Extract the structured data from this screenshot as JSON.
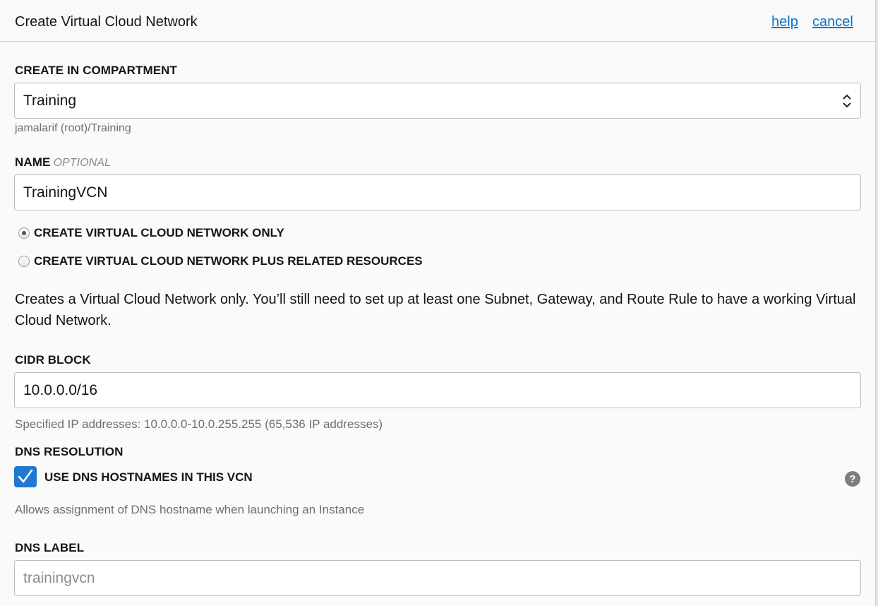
{
  "header": {
    "title": "Create Virtual Cloud Network",
    "help_label": "help",
    "cancel_label": "cancel"
  },
  "compartment": {
    "label": "CREATE IN COMPARTMENT",
    "value": "Training",
    "path": "jamalarif (root)/Training"
  },
  "name": {
    "label": "NAME",
    "optional": "OPTIONAL",
    "value": "TrainingVCN"
  },
  "create_mode": {
    "options": [
      {
        "label": "CREATE VIRTUAL CLOUD NETWORK ONLY",
        "selected": true
      },
      {
        "label": "CREATE VIRTUAL CLOUD NETWORK PLUS RELATED RESOURCES",
        "selected": false
      }
    ],
    "description": "Creates a Virtual Cloud Network only. You’ll still need to set up at least one Subnet, Gateway, and Route Rule to have a working Virtual Cloud Network."
  },
  "cidr": {
    "label": "CIDR BLOCK",
    "value": "10.0.0.0/16",
    "hint": "Specified IP addresses: 10.0.0.0-10.0.255.255 (65,536 IP addresses)"
  },
  "dns": {
    "label": "DNS RESOLUTION",
    "checkbox_label": "USE DNS HOSTNAMES IN THIS VCN",
    "checked": true,
    "hint": "Allows assignment of DNS hostname when launching an Instance",
    "help_icon": "question-circle-icon",
    "help_glyph": "?"
  },
  "dns_label": {
    "label": "DNS LABEL",
    "placeholder": "trainingvcn"
  },
  "colors": {
    "accent": "#0572ce",
    "checkbox": "#1f78d1"
  }
}
